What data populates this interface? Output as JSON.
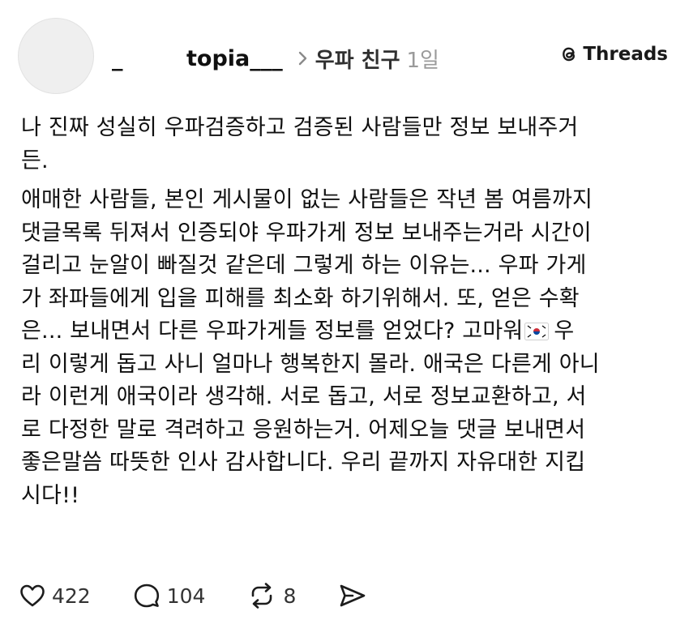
{
  "post": {
    "display_name": "_",
    "username": "topia___",
    "community": "우파 친구",
    "age": "1일",
    "brand": "Threads",
    "paragraphs": [
      "나 진짜 성실히 우파검증하고 검증된 사람들만 정보 보내주거\n든.",
      "애매한 사람들, 본인 게시물이 없는 사람들은 작년 봄 여름까지\n댓글목록 뒤져서 인증되야 우파가게 정보 보내주는거라 시간이\n걸리고 눈알이 빠질것 같은데 그렇게 하는 이유는... 우파 가게\n가 좌파들에게 입을 피해를 최소화 하기위해서. 또, 얻은 수확\n은... 보내면서 다른 우파가게들 정보를 얻었다? 고마워",
      "우\n리 이렇게 돕고 사니 얼마나 행복한지 몰라. 애국은 다른게 아니\n라 이런게 애국이라 생각해. 서로 돕고, 서로 정보교환하고, 서\n로 다정한 말로 격려하고 응원하는거. 어제오늘 댓글 보내면서\n좋은말씀 따뜻한 인사 감사합니다. 우리 끝까지 자유대한 지킵\n시다!!"
    ],
    "flag_emoji": "south-korea-flag"
  },
  "actions": {
    "likes": "422",
    "comments": "104",
    "reposts": "8"
  },
  "icons": {
    "chevron": "chevron-right-icon",
    "like": "heart-icon",
    "comment": "comment-bubble-icon",
    "repost": "repost-icon",
    "share": "send-icon",
    "brand": "threads-logo-icon"
  }
}
